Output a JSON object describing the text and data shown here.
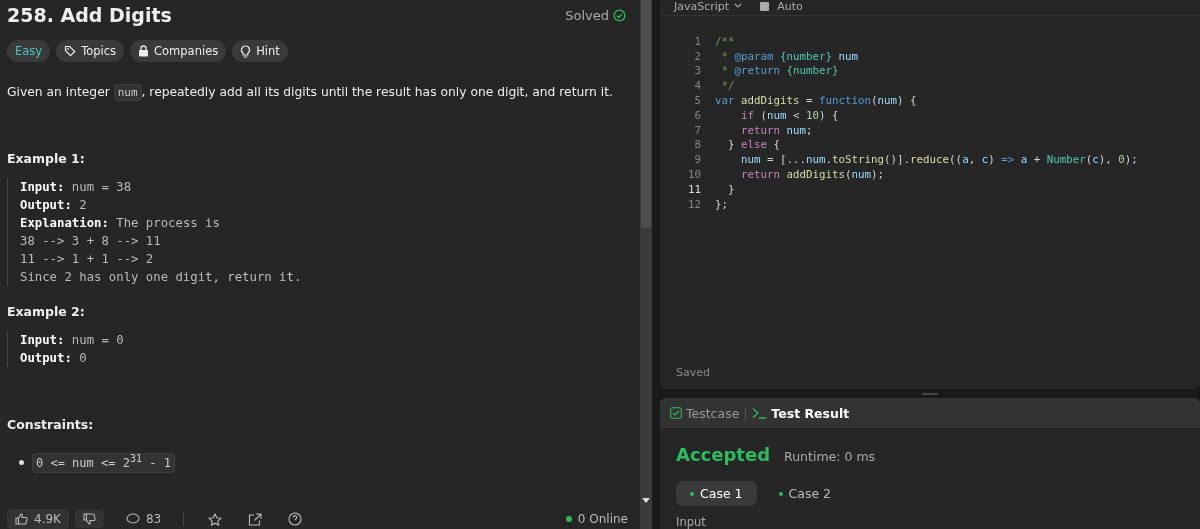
{
  "problem": {
    "title": "258. Add Digits",
    "status": "Solved",
    "tags": [
      {
        "label": "Easy",
        "kind": "difficulty"
      },
      {
        "label": "Topics",
        "kind": "tag"
      },
      {
        "label": "Companies",
        "kind": "lock"
      },
      {
        "label": "Hint",
        "kind": "bulb"
      }
    ],
    "description": {
      "before": "Given an integer ",
      "code": "num",
      "after": ", repeatedly add all its digits until the result has only one digit, and return it."
    },
    "examples": [
      {
        "title": "Example 1:",
        "lines": [
          {
            "label": "Input:",
            "text": "num = 38"
          },
          {
            "label": "Output:",
            "text": "2"
          },
          {
            "label": "Explanation:",
            "text": "The process is"
          },
          {
            "text": "38 --> 3 + 8 --> 11"
          },
          {
            "text": "11 --> 1 + 1 --> 2"
          },
          {
            "text": "Since 2 has only one digit, return it."
          }
        ]
      },
      {
        "title": "Example 2:",
        "lines": [
          {
            "label": "Input:",
            "text": "num = 0"
          },
          {
            "label": "Output:",
            "text": "0"
          }
        ]
      }
    ],
    "constraints_title": "Constraints:",
    "constraints": [
      "0 <= num <= 2$^{31}$ - 1"
    ],
    "footer": {
      "likes": "4.9K",
      "comments": "83",
      "online": "0 Online"
    }
  },
  "editor": {
    "language": "JavaScript",
    "mode": "Auto",
    "status": "Saved",
    "lines": [
      {
        "number": "1",
        "current": false,
        "tokens": [
          {
            "text": "/**",
            "kind": "comment"
          }
        ]
      },
      {
        "number": "2",
        "current": false,
        "tokens": [
          {
            "text": " * ",
            "kind": "comment"
          },
          {
            "text": "@param",
            "kind": "keyword"
          },
          {
            "text": " {number}",
            "kind": "type"
          },
          {
            "text": " num",
            "kind": "var"
          }
        ]
      },
      {
        "number": "3",
        "current": false,
        "tokens": [
          {
            "text": " * ",
            "kind": "comment"
          },
          {
            "text": "@return",
            "kind": "keyword"
          },
          {
            "text": " {number}",
            "kind": "type"
          }
        ]
      },
      {
        "number": "4",
        "current": false,
        "tokens": [
          {
            "text": " */",
            "kind": "comment"
          }
        ]
      },
      {
        "number": "5",
        "current": false,
        "tokens": [
          {
            "text": "var",
            "kind": "keyword"
          },
          {
            "text": " addDigits",
            "kind": "func"
          },
          {
            "text": " = ",
            "kind": "plain"
          },
          {
            "text": "function",
            "kind": "keyword"
          },
          {
            "text": "(",
            "kind": "plain"
          },
          {
            "text": "num",
            "kind": "var"
          },
          {
            "text": ") {",
            "kind": "plain"
          }
        ]
      },
      {
        "number": "6",
        "current": false,
        "tokens": [
          {
            "text": "    if",
            "kind": "control"
          },
          {
            "text": " (",
            "kind": "plain"
          },
          {
            "text": "num",
            "kind": "var"
          },
          {
            "text": " < ",
            "kind": "plain"
          },
          {
            "text": "10",
            "kind": "num"
          },
          {
            "text": ") {",
            "kind": "plain"
          }
        ]
      },
      {
        "number": "7",
        "current": false,
        "tokens": [
          {
            "text": "    return",
            "kind": "control"
          },
          {
            "text": " num",
            "kind": "var"
          },
          {
            "text": ";",
            "kind": "plain"
          }
        ]
      },
      {
        "number": "8",
        "current": false,
        "tokens": [
          {
            "text": "  } ",
            "kind": "plain"
          },
          {
            "text": "else",
            "kind": "control"
          },
          {
            "text": " {",
            "kind": "plain"
          }
        ]
      },
      {
        "number": "9",
        "current": false,
        "tokens": [
          {
            "text": "    num",
            "kind": "var"
          },
          {
            "text": " = [...",
            "kind": "plain"
          },
          {
            "text": "num",
            "kind": "var"
          },
          {
            "text": ".",
            "kind": "plain"
          },
          {
            "text": "toString",
            "kind": "func"
          },
          {
            "text": "()].",
            "kind": "plain"
          },
          {
            "text": "reduce",
            "kind": "func"
          },
          {
            "text": "((",
            "kind": "plain"
          },
          {
            "text": "a",
            "kind": "var"
          },
          {
            "text": ", ",
            "kind": "plain"
          },
          {
            "text": "c",
            "kind": "var"
          },
          {
            "text": ") ",
            "kind": "plain"
          },
          {
            "text": "=>",
            "kind": "keyword"
          },
          {
            "text": " a",
            "kind": "var"
          },
          {
            "text": " + ",
            "kind": "plain"
          },
          {
            "text": "Number",
            "kind": "type"
          },
          {
            "text": "(",
            "kind": "plain"
          },
          {
            "text": "c",
            "kind": "var"
          },
          {
            "text": "), ",
            "kind": "plain"
          },
          {
            "text": "0",
            "kind": "num"
          },
          {
            "text": ");",
            "kind": "plain"
          }
        ]
      },
      {
        "number": "10",
        "current": false,
        "tokens": [
          {
            "text": "    return",
            "kind": "control"
          },
          {
            "text": " addDigits",
            "kind": "func"
          },
          {
            "text": "(",
            "kind": "plain"
          },
          {
            "text": "num",
            "kind": "var"
          },
          {
            "text": ");",
            "kind": "plain"
          }
        ]
      },
      {
        "number": "11",
        "current": true,
        "tokens": [
          {
            "text": "  }",
            "kind": "plain"
          }
        ]
      },
      {
        "number": "12",
        "current": false,
        "tokens": [
          {
            "text": "};",
            "kind": "plain"
          }
        ]
      }
    ]
  },
  "console": {
    "tabs": [
      {
        "label": "Testcase",
        "kind": "testcase",
        "selected": false
      },
      {
        "label": "Test Result",
        "kind": "result",
        "selected": true
      }
    ],
    "verdict": "Accepted",
    "runtime": "Runtime: 0 ms",
    "cases": [
      {
        "label": "Case 1",
        "selected": true
      },
      {
        "label": "Case 2",
        "selected": false
      }
    ],
    "section": "Input"
  }
}
